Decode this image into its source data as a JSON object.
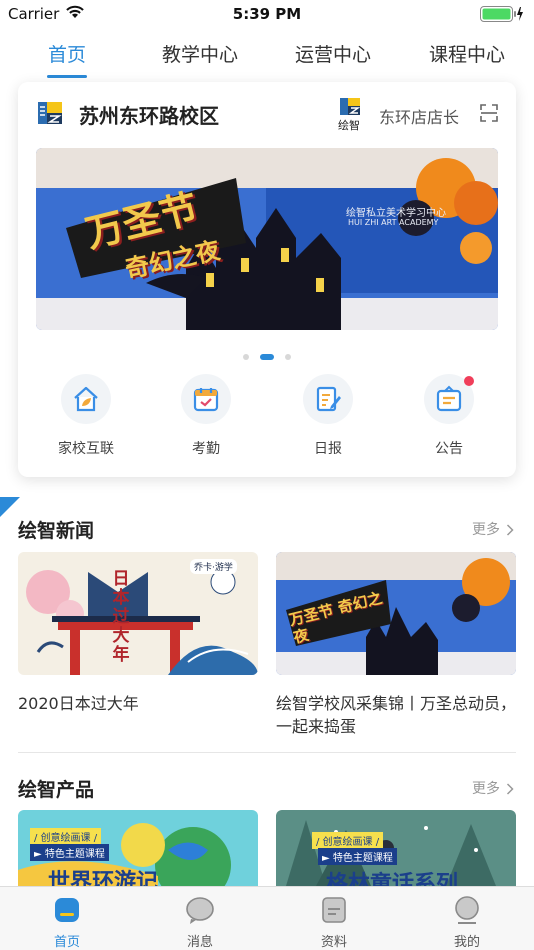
{
  "status_bar": {
    "carrier": "Carrier",
    "time": "5:39 PM"
  },
  "tabs": [
    {
      "label": "首页",
      "active": true
    },
    {
      "label": "教学中心",
      "active": false
    },
    {
      "label": "运营中心",
      "active": false
    },
    {
      "label": "课程中心",
      "active": false
    }
  ],
  "card": {
    "school_name": "苏州东环路校区",
    "brand_small_text": "绘智",
    "role": "东环店店长",
    "banner": {
      "headline_1": "万圣节",
      "headline_2": "奇幻之夜",
      "sign": "绘智私立美术学习中心",
      "sign_en": "HUI ZHI ART ACADEMY"
    },
    "carousel": {
      "count": 3,
      "active_index": 1
    },
    "quick_actions": [
      {
        "label": "家校互联",
        "icon": "home-leaf-icon",
        "badge": false
      },
      {
        "label": "考勤",
        "icon": "calendar-check-icon",
        "badge": false
      },
      {
        "label": "日报",
        "icon": "report-edit-icon",
        "badge": false
      },
      {
        "label": "公告",
        "icon": "notice-board-icon",
        "badge": true
      }
    ]
  },
  "news": {
    "title": "绘智新闻",
    "more": "更多",
    "items": [
      {
        "title": "2020日本过大年",
        "thumb_text": "日本过大年",
        "thumb_logo": "乔卡·游学"
      },
      {
        "title": "绘智学校风采集锦丨万圣总动员，一起来捣蛋",
        "thumb_text": "万圣节 奇幻之夜"
      }
    ]
  },
  "products": {
    "title": "绘智产品",
    "more": "更多",
    "items": [
      {
        "tag_1": "/ 创意绘画课 /",
        "tag_2": "► 特色主题课程",
        "big_text": "世界环游记"
      },
      {
        "tag_1": "/ 创意绘画课 /",
        "tag_2": "► 特色主题课程",
        "big_text": "格林童话系列"
      }
    ]
  },
  "bottom_nav": [
    {
      "label": "首页",
      "icon": "home-icon",
      "active": true
    },
    {
      "label": "消息",
      "icon": "message-icon",
      "active": false
    },
    {
      "label": "资料",
      "icon": "document-icon",
      "active": false
    },
    {
      "label": "我的",
      "icon": "profile-icon",
      "active": false
    }
  ],
  "colors": {
    "accent": "#2b8ad8",
    "badge": "#f03e5a",
    "battery": "#4cd964"
  }
}
